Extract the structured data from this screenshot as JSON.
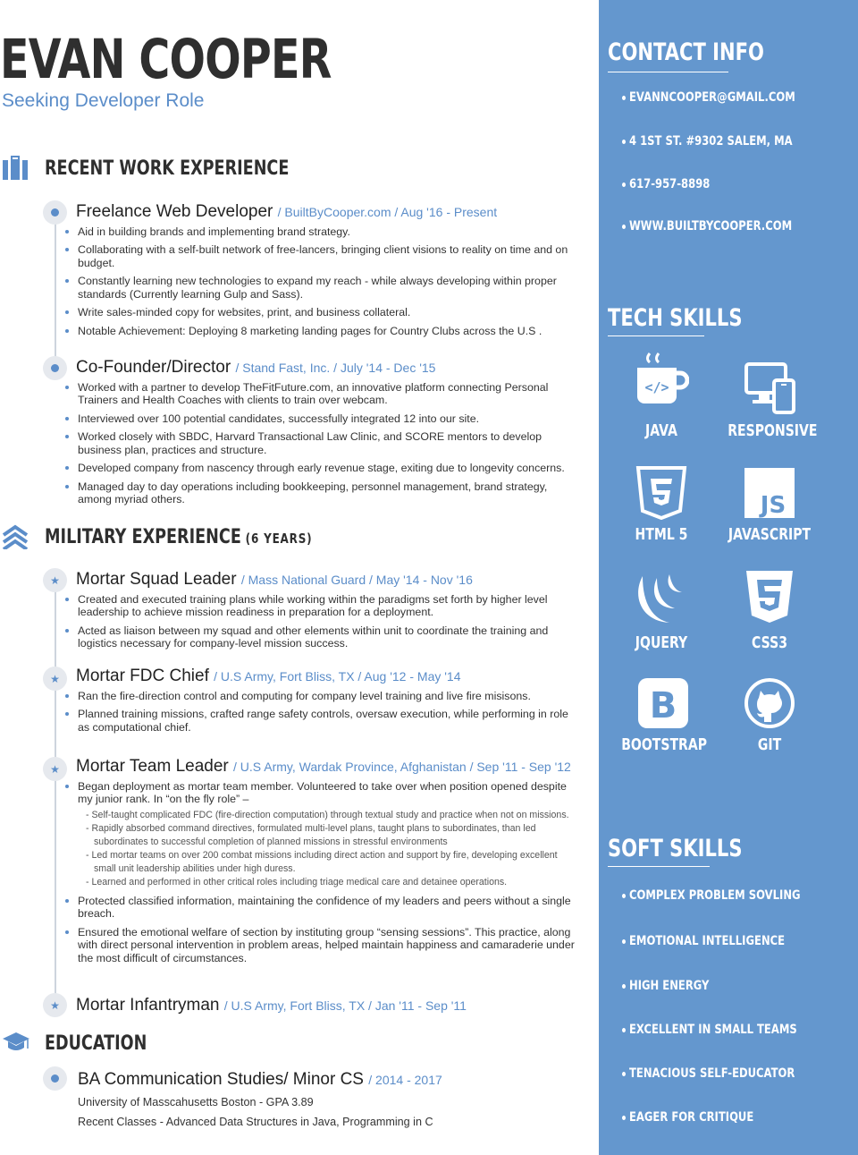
{
  "header": {
    "name": "EVAN COOPER",
    "tagline": "Seeking Developer Role"
  },
  "work": {
    "title": "RECENT WORK EXPERIENCE",
    "jobs": [
      {
        "role": "Freelance Web Developer",
        "meta": "/  BuiltByCooper.com  /  Aug '16 - Present",
        "bullets": [
          "Aid in building brands and implementing brand strategy.",
          "Collaborating with a self-built network of free-lancers, bringing client visions to reality on time and on budget.",
          "Constantly learning new technologies to expand my reach - while always developing within proper standards (Currently learning Gulp and Sass).",
          "Write sales-minded copy for websites, print, and business collateral.",
          "Notable Achievement: Deploying 8 marketing landing pages for Country Clubs across the U.S ."
        ]
      },
      {
        "role": "Co-Founder/Director",
        "meta": "/ Stand Fast, Inc. / July '14 - Dec '15",
        "bullets": [
          "Worked with a partner to develop TheFitFuture.com, an innovative platform connecting Personal Trainers and Health Coaches with clients to train over webcam.",
          "Interviewed over 100 potential candidates, successfully integrated 12 into our site.",
          "Worked closely with SBDC, Harvard Transactional Law Clinic, and SCORE mentors to develop business plan, practices and structure.",
          "Developed company from nascency through early revenue stage, exiting due to longevity concerns.",
          "Managed day to day operations including bookkeeping, personnel management, brand strategy, among myriad others."
        ]
      }
    ]
  },
  "military": {
    "title": "MILITARY EXPERIENCE",
    "subtitle": "(6 YEARS)",
    "jobs": [
      {
        "role": "Mortar Squad Leader",
        "meta": "/ Mass National Guard / May '14 - Nov '16",
        "bullets": [
          "Created and executed training plans while working within the paradigms set forth by higher level leadership to achieve mission readiness in preparation for a deployment.",
          "Acted as liaison between my squad and other elements within unit to coordinate the training and logistics necessary for company-level mission success."
        ]
      },
      {
        "role": "Mortar FDC Chief",
        "meta": "/ U.S Army, Fort Bliss, TX /  Aug '12 - May '14",
        "bullets": [
          "Ran the fire-direction control and computing for company level training and live fire misisons.",
          "Planned training missions, crafted range safety controls, oversaw execution, while performing in role as computational chief."
        ]
      },
      {
        "role": "Mortar Team Leader",
        "meta": "/ U.S Army, Wardak Province, Afghanistan / Sep '11 - Sep '12",
        "bullet_intro": "Began deployment as mortar team member. Volunteered to take over when position opened despite my junior rank. In “on the fly role” –",
        "subbullets": [
          "Self-taught complicated FDC (fire-direction computation) through textual study and practice when not on missions.",
          "Rapidly absorbed command directives, formulated multi-level plans, taught plans to subordinates, than led subordinates to successful completion of planned missions in stressful environments",
          "Led mortar teams on over 200 combat missions including direct action and support by fire, developing excellent small unit leadership abilities under high duress.",
          "Learned and performed in other critical roles including triage medical care and detainee operations."
        ],
        "bullets": [
          "Protected classified information, maintaining the confidence of my leaders and peers without a single breach.",
          "Ensured the emotional welfare of section by instituting group “sensing sessions”. This practice, along with direct personal intervention in problem areas, helped maintain happiness and camaraderie under the most difficult of circumstances."
        ]
      },
      {
        "role": "Mortar Infantryman",
        "meta": "/ U.S Army, Fort Bliss, TX /  Jan '11 - Sep '11"
      }
    ]
  },
  "education": {
    "title": "EDUCATION",
    "degree": "BA Communication Studies/ Minor CS",
    "years": "/  2014 - 2017",
    "school": "University of Masscahusetts Boston - GPA 3.89",
    "classes": "Recent Classes - Advanced Data Structures in Java, Programming in C"
  },
  "contact": {
    "title": "CONTACT INFO",
    "email": "EVANNCOOPER@GMAIL.COM",
    "address": "4 1ST ST. #9302 SALEM, MA",
    "phone": "617-957-8898",
    "website": "WWW.BUILTBYCOOPER.COM"
  },
  "tech": {
    "title": "TECH SKILLS",
    "skills": {
      "java": "JAVA",
      "responsive": "RESPONSIVE",
      "html5": "HTML 5",
      "javascript": "JAVASCRIPT",
      "jquery": "JQUERY",
      "css3": "CSS3",
      "bootstrap": "BOOTSTRAP",
      "git": "GIT"
    },
    "icons": [
      "java-icon",
      "responsive-icon",
      "html5-icon",
      "javascript-icon",
      "jquery-icon",
      "css3-icon",
      "bootstrap-icon",
      "git-icon"
    ]
  },
  "soft": {
    "title": "SOFT SKILLS",
    "items": [
      "COMPLEX PROBLEM SOVLING",
      "EMOTIONAL INTELLIGENCE",
      "HIGH ENERGY",
      "EXCELLENT IN SMALL TEAMS",
      "TENACIOUS SELF-EDUCATOR",
      "EAGER FOR CRITIQUE"
    ]
  },
  "colors": {
    "accent": "#5b8dc9",
    "sidebar": "#6497ce",
    "text": "#2f2f2f"
  }
}
